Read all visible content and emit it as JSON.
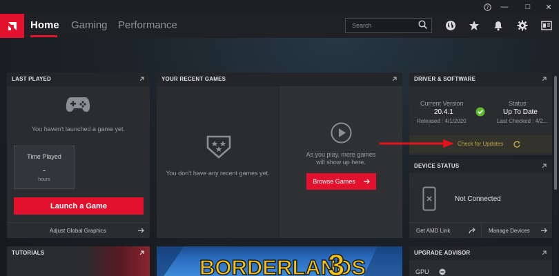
{
  "window": {
    "help_glyph": "?",
    "minimize_glyph": "—",
    "maximize_glyph": "□",
    "close_glyph": "✕"
  },
  "nav": {
    "tabs": [
      "Home",
      "Gaming",
      "Performance"
    ],
    "search_placeholder": "Search"
  },
  "last_played": {
    "title": "LAST PLAYED",
    "empty_text": "You haven't launched a game yet.",
    "time_played_label": "Time Played",
    "time_played_value": "-",
    "time_played_unit": "hours",
    "launch_button": "Launch a Game",
    "footer_link": "Adjust Global Graphics"
  },
  "recent_games": {
    "title": "YOUR RECENT GAMES",
    "empty_text": "You don't have any recent games yet.",
    "play_text_line1": "As you play, more games",
    "play_text_line2": "will show up here.",
    "browse_button": "Browse Games"
  },
  "driver": {
    "title": "DRIVER & SOFTWARE",
    "current_version_label": "Current Version",
    "current_version": "20.4.1",
    "released": "Released : 4/1/2020",
    "status_label": "Status",
    "status_value": "Up To Date",
    "last_checked": "Last Checked : 4/2...",
    "check_updates": "Check for Updates"
  },
  "device_status": {
    "title": "DEVICE STATUS",
    "status": "Not Connected",
    "link_left": "Get AMD Link",
    "link_right": "Manage Devices"
  },
  "tutorials": {
    "title": "TUTORIALS"
  },
  "featured_game": {
    "art_text": "BORDERLANDS",
    "art_number": "3"
  },
  "upgrade_advisor": {
    "title": "UPGRADE ADVISOR",
    "row_label": "GPU"
  },
  "colors": {
    "accent": "#e2122e",
    "ok_green": "#5dbb2f",
    "highlight_yellow": "#bfa94a"
  }
}
